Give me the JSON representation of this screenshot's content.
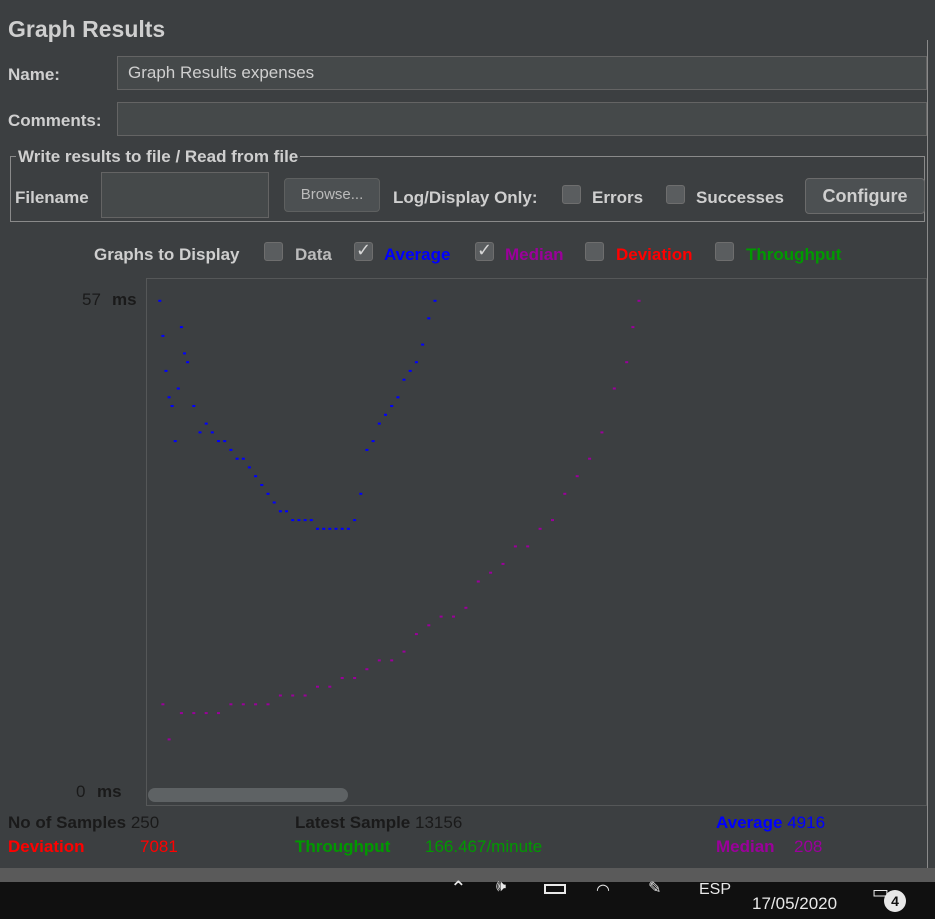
{
  "header": {
    "title": "Graph Results"
  },
  "name_field": {
    "label": "Name:",
    "value": "Graph Results expenses"
  },
  "comments_field": {
    "label": "Comments:",
    "value": ""
  },
  "file_group": {
    "title": "Write results to file / Read from file",
    "filename_label": "Filename",
    "filename_value": "",
    "browse_label": "Browse...",
    "log_label": "Log/Display Only:",
    "errors_label": "Errors",
    "errors_checked": false,
    "successes_label": "Successes",
    "successes_checked": false,
    "configure_label": "Configure"
  },
  "graphs": {
    "label": "Graphs to Display",
    "options": [
      {
        "name": "Data",
        "checked": false,
        "color": "#1a1a1a"
      },
      {
        "name": "Average",
        "checked": true,
        "color": "#0000ff"
      },
      {
        "name": "Median",
        "checked": true,
        "color": "#9b009b"
      },
      {
        "name": "Deviation",
        "checked": false,
        "color": "#ff0000"
      },
      {
        "name": "Throughput",
        "checked": false,
        "color": "#009900"
      }
    ]
  },
  "chart_data": {
    "type": "scatter",
    "y_max_value": "57",
    "y_max_unit": "ms",
    "y_min_value": "0",
    "y_min_unit": "ms",
    "ylim": [
      0,
      57
    ],
    "xlim": [
      0,
      250
    ],
    "series": [
      {
        "name": "Average",
        "color": "#0000ff",
        "x": [
          3,
          4,
          5,
          6,
          7,
          8,
          9,
          10,
          11,
          12,
          14,
          16,
          18,
          20,
          22,
          24,
          26,
          28,
          30,
          32,
          34,
          36,
          38,
          40,
          42,
          44,
          46,
          48,
          50,
          52,
          54,
          56,
          58,
          60,
          62,
          64,
          66,
          68,
          70,
          72,
          74,
          76,
          78,
          80,
          82,
          84,
          86,
          88,
          90,
          92
        ],
        "y": [
          56,
          52,
          48,
          45,
          44,
          40,
          46,
          53,
          50,
          49,
          44,
          41,
          42,
          41,
          40,
          40,
          39,
          38,
          38,
          37,
          36,
          35,
          34,
          33,
          32,
          32,
          31,
          31,
          31,
          31,
          30,
          30,
          30,
          30,
          30,
          30,
          31,
          34,
          39,
          40,
          42,
          43,
          44,
          45,
          47,
          48,
          49,
          51,
          54,
          56
        ]
      },
      {
        "name": "Median",
        "color": "#9b009b",
        "x": [
          4,
          6,
          10,
          14,
          18,
          22,
          26,
          30,
          34,
          38,
          42,
          46,
          50,
          54,
          58,
          62,
          66,
          70,
          74,
          78,
          82,
          86,
          90,
          94,
          98,
          102,
          106,
          110,
          114,
          118,
          122,
          126,
          130,
          134,
          138,
          142,
          146,
          150,
          154,
          156,
          158
        ],
        "y": [
          10,
          6,
          9,
          9,
          9,
          9,
          10,
          10,
          10,
          10,
          11,
          11,
          11,
          12,
          12,
          13,
          13,
          14,
          15,
          15,
          16,
          18,
          19,
          20,
          20,
          21,
          24,
          25,
          26,
          28,
          28,
          30,
          31,
          34,
          36,
          38,
          41,
          46,
          49,
          53,
          56
        ]
      }
    ]
  },
  "stats": {
    "samples_label": "No of Samples",
    "samples_value": "250",
    "latest_label": "Latest Sample",
    "latest_value": "13156",
    "average_label": "Average",
    "average_value": "4916",
    "deviation_label": "Deviation",
    "deviation_value": "7081",
    "throughput_label": "Throughput",
    "throughput_value": "166.467/minute",
    "median_label": "Median",
    "median_value": "208"
  },
  "taskbar": {
    "language": "ESP",
    "date": "17/05/2020",
    "time": "",
    "notification_count": "4"
  },
  "colors": {
    "average": "#0000ff",
    "median": "#9b009b",
    "deviation": "#ff0000",
    "throughput": "#009900"
  }
}
